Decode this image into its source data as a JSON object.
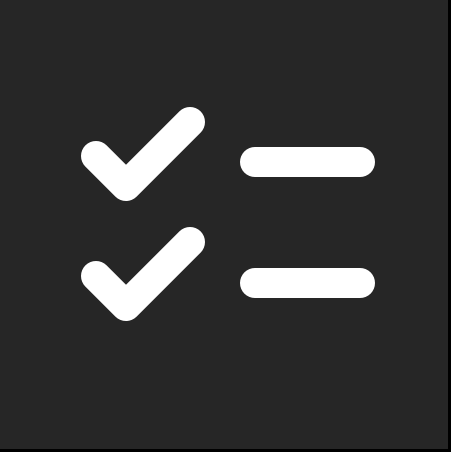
{
  "icon": {
    "name": "checklist-icon",
    "items": [
      {
        "name": "check-item-1",
        "checked": true
      },
      {
        "name": "check-item-2",
        "checked": true
      }
    ]
  },
  "colors": {
    "background": "#262626",
    "foreground": "#ffffff",
    "frame": "#000000"
  }
}
